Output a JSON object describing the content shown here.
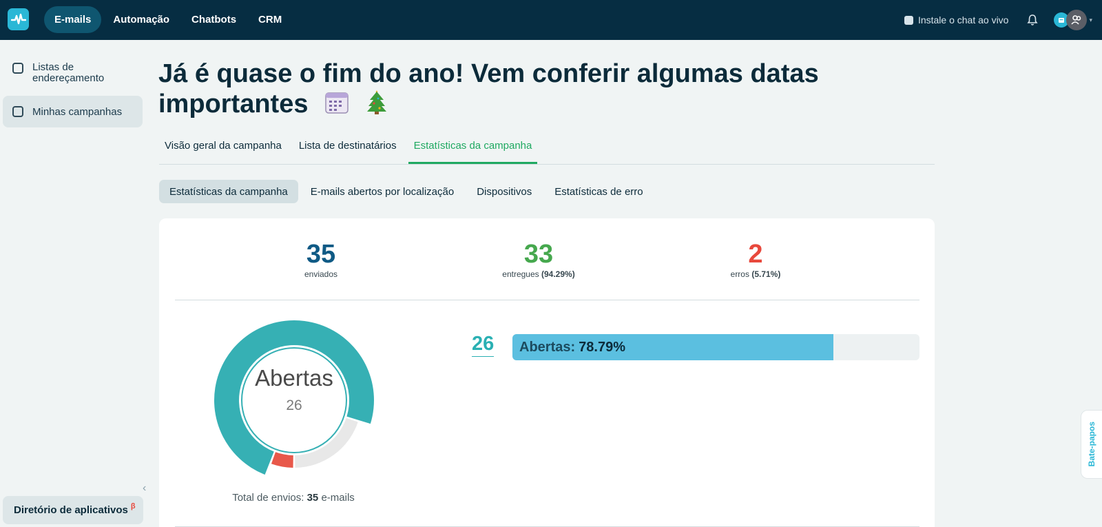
{
  "nav": {
    "items": [
      {
        "label": "E-mails",
        "active": true
      },
      {
        "label": "Automação",
        "active": false
      },
      {
        "label": "Chatbots",
        "active": false
      },
      {
        "label": "CRM",
        "active": false
      }
    ],
    "live_chat_label": "Instale o chat ao vivo"
  },
  "sidebar": {
    "items": [
      {
        "label": "Listas de endereçamento",
        "icon": "contacts-icon"
      },
      {
        "label": "Minhas campanhas",
        "icon": "campaign-icon"
      }
    ],
    "app_directory_label": "Diretório de aplicativos",
    "beta_mark": "β"
  },
  "page": {
    "title": "Já é quase o fim do ano! Vem conferir algumas datas importantes",
    "title_emojis": [
      "🗓️",
      "🎄"
    ]
  },
  "tabs": [
    {
      "label": "Visão geral da campanha",
      "active": false
    },
    {
      "label": "Lista de destinatários",
      "active": false
    },
    {
      "label": "Estatísticas da campanha",
      "active": true
    }
  ],
  "subtabs": [
    {
      "label": "Estatísticas da campanha",
      "active": true
    },
    {
      "label": "E-mails abertos por localização",
      "active": false
    },
    {
      "label": "Dispositivos",
      "active": false
    },
    {
      "label": "Estatísticas de erro",
      "active": false
    }
  ],
  "stats": {
    "sent": {
      "value": "35",
      "label": "enviados",
      "color": "#0f5a85"
    },
    "delivered": {
      "value": "33",
      "label": "entregues",
      "percent": "(94.29%)",
      "color": "#46a84e"
    },
    "errors": {
      "value": "2",
      "label": "erros",
      "percent": "(5.71%)",
      "color": "#e8483c"
    }
  },
  "chart_data": {
    "type": "pie",
    "title": "Abertas",
    "center_value": "26",
    "slices": [
      {
        "label": "Abertas",
        "value": 26,
        "color": "#36b0b4"
      },
      {
        "label": "Não abertas",
        "value": 7,
        "color": "#e8e8e8"
      },
      {
        "label": "Erros",
        "value": 2,
        "color": "#e8584a"
      }
    ],
    "total_prefix": "Total de envios:",
    "total_value": "35",
    "total_suffix": "e-mails"
  },
  "opens_bar": {
    "count": "26",
    "label": "Abertas:",
    "value": "78.79%",
    "fraction": 0.7879
  },
  "chat_tab_label": "Bate-papos"
}
